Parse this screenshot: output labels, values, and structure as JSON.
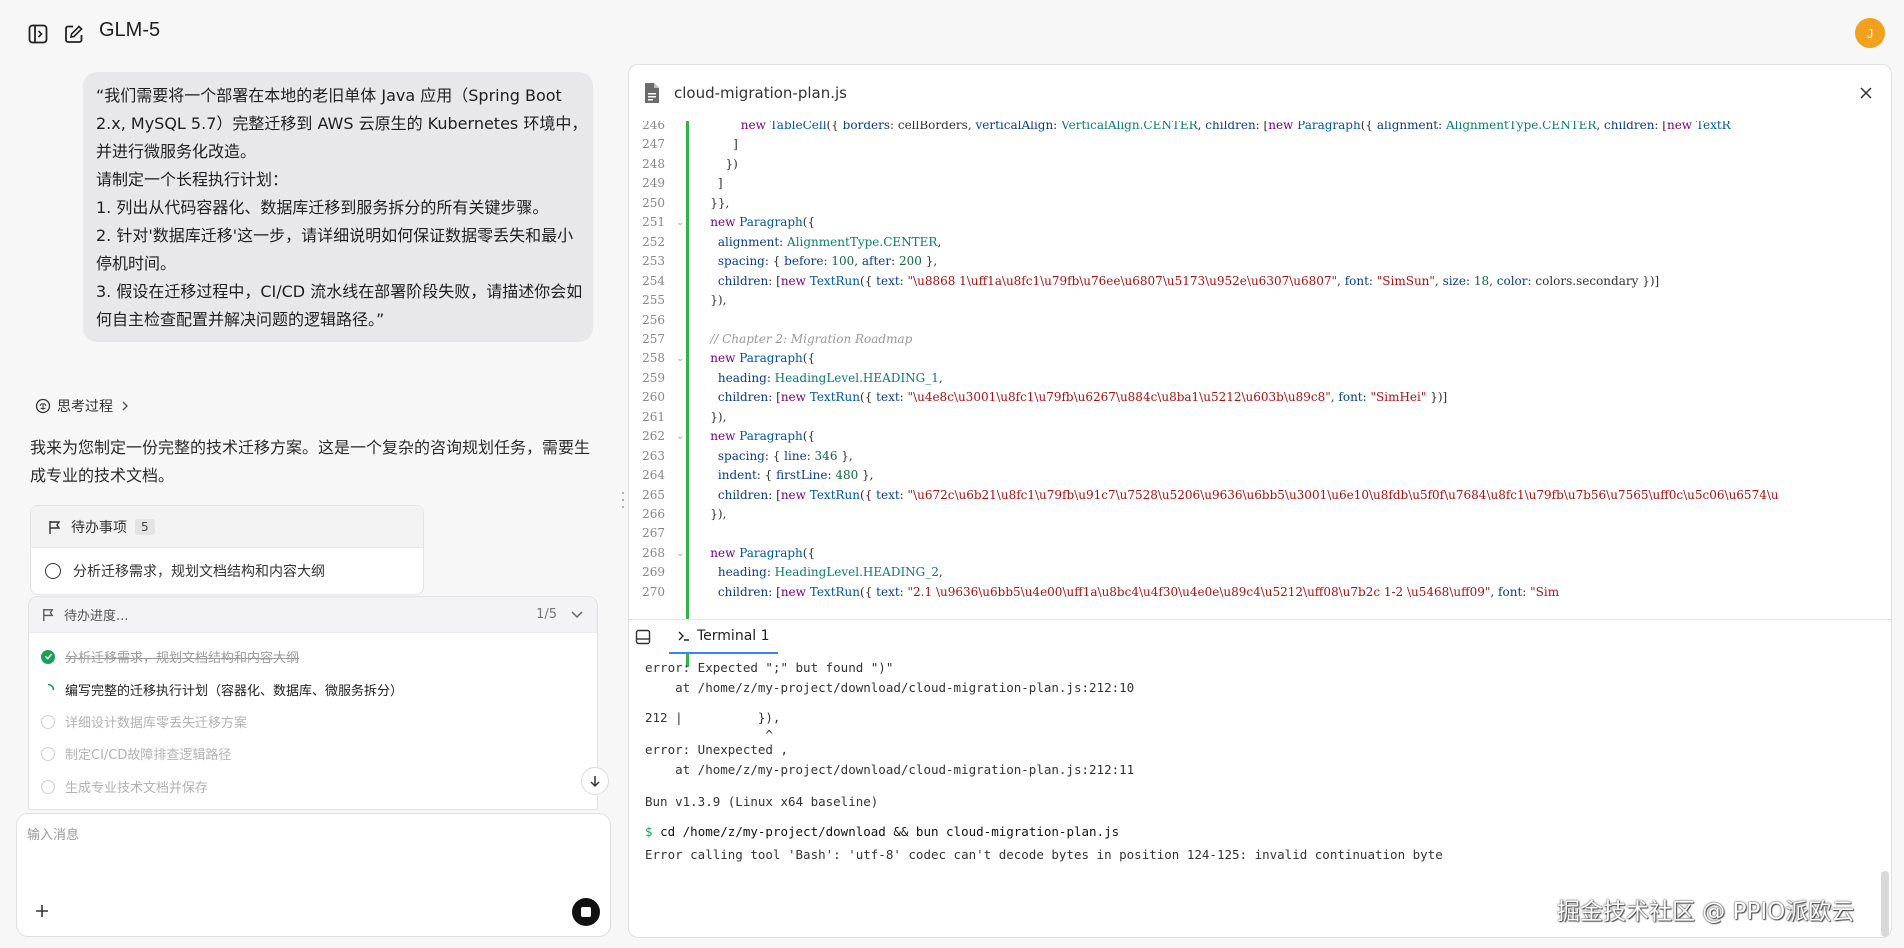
{
  "app": {
    "title": "GLM-5",
    "avatar_letter": "J"
  },
  "user_message": {
    "lines": [
      "“我们需要将一个部署在本地的老旧单体 Java 应用（Spring Boot",
      "2.x, MySQL 5.7）完整迁移到 AWS 云原生的 Kubernetes 环境中，",
      "并进行微服务化改造。",
      "请制定一个长程执行计划：",
      "1. 列出从代码容器化、数据库迁移到服务拆分的所有关键步骤。",
      "2. 针对'数据库迁移'这一步，请详细说明如何保证数据零丢失和最小",
      "停机时间。",
      "3. 假设在迁移过程中，CI/CD 流水线在部署阶段失败，请描述你会如",
      "何自主检查配置并解决问题的逻辑路径。”"
    ]
  },
  "thinking_label": "思考过程",
  "assistant_lines": [
    "我来为您制定一份完整的技术迁移方案。这是一个复杂的咨询规划任务，需要生",
    "成专业的技术文档。"
  ],
  "todo_card": {
    "title": "待办事项",
    "count": "5",
    "first_item": "分析迁移需求，规划文档结构和内容大纲"
  },
  "progress": {
    "title": "待办进度...",
    "count": "1/5",
    "items": [
      {
        "label": "分析迁移需求，规划文档结构和内容大纲",
        "state": "done"
      },
      {
        "label": "编写完整的迁移执行计划（容器化、数据库、微服务拆分）",
        "state": "active"
      },
      {
        "label": "详细设计数据库零丢失迁移方案",
        "state": "pending"
      },
      {
        "label": "制定CI/CD故障排查逻辑路径",
        "state": "pending"
      },
      {
        "label": "生成专业技术文档并保存",
        "state": "pending"
      }
    ]
  },
  "composer": {
    "placeholder": "输入消息"
  },
  "editor": {
    "file_name": "cloud-migration-plan.js",
    "lines": [
      {
        "n": "246",
        "fold": "",
        "code": "            new TableCell({ borders: cellBorders, verticalAlign: VerticalAlign.CENTER, children: [new Paragraph({ alignment: AlignmentType.CENTER, children: [new TextR"
      },
      {
        "n": "247",
        "fold": "",
        "code": "          ]"
      },
      {
        "n": "248",
        "fold": "",
        "code": "        })"
      },
      {
        "n": "249",
        "fold": "",
        "code": "      ]"
      },
      {
        "n": "250",
        "fold": "",
        "code": "    }},"
      },
      {
        "n": "251",
        "fold": "v",
        "code": "    new Paragraph({"
      },
      {
        "n": "252",
        "fold": "",
        "code": "      alignment: AlignmentType.CENTER,"
      },
      {
        "n": "253",
        "fold": "",
        "code": "      spacing: { before: 100, after: 200 },"
      },
      {
        "n": "254",
        "fold": "",
        "code": "      children: [new TextRun({ text: \"\\u8868 1\\uff1a\\u8fc1\\u79fb\\u76ee\\u6807\\u5173\\u952e\\u6307\\u6807\", font: \"SimSun\", size: 18, color: colors.secondary })]"
      },
      {
        "n": "255",
        "fold": "",
        "code": "    }),"
      },
      {
        "n": "256",
        "fold": "",
        "code": ""
      },
      {
        "n": "257",
        "fold": "",
        "code": "    // Chapter 2: Migration Roadmap"
      },
      {
        "n": "258",
        "fold": "v",
        "code": "    new Paragraph({"
      },
      {
        "n": "259",
        "fold": "",
        "code": "      heading: HeadingLevel.HEADING_1,"
      },
      {
        "n": "260",
        "fold": "",
        "code": "      children: [new TextRun({ text: \"\\u4e8c\\u3001\\u8fc1\\u79fb\\u6267\\u884c\\u8ba1\\u5212\\u603b\\u89c8\", font: \"SimHei\" })]"
      },
      {
        "n": "261",
        "fold": "",
        "code": "    }),"
      },
      {
        "n": "262",
        "fold": "v",
        "code": "    new Paragraph({"
      },
      {
        "n": "263",
        "fold": "",
        "code": "      spacing: { line: 346 },"
      },
      {
        "n": "264",
        "fold": "",
        "code": "      indent: { firstLine: 480 },"
      },
      {
        "n": "265",
        "fold": "",
        "code": "      children: [new TextRun({ text: \"\\u672c\\u6b21\\u8fc1\\u79fb\\u91c7\\u7528\\u5206\\u9636\\u6bb5\\u3001\\u6e10\\u8fdb\\u5f0f\\u7684\\u8fc1\\u79fb\\u7b56\\u7565\\uff0c\\u5c06\\u6574\\u"
      },
      {
        "n": "266",
        "fold": "",
        "code": "    }),"
      },
      {
        "n": "267",
        "fold": "",
        "code": ""
      },
      {
        "n": "268",
        "fold": "v",
        "code": "    new Paragraph({"
      },
      {
        "n": "269",
        "fold": "",
        "code": "      heading: HeadingLevel.HEADING_2,"
      },
      {
        "n": "270",
        "fold": "",
        "code": "      children: [new TextRun({ text: \"2.1 \\u9636\\u6bb5\\u4e00\\uff1a\\u8bc4\\u4f30\\u4e0e\\u89c4\\u5212\\uff08\\u7b2c 1-2 \\u5468\\uff09\", font: \"Sim"
      }
    ]
  },
  "terminal": {
    "tab_label": "Terminal 1",
    "lines": [
      {
        "text": "error: Expected \";\" but found \")\"",
        "kind": "plain"
      },
      {
        "text": "    at /home/z/my-project/download/cloud-migration-plan.js:212:10",
        "kind": "plain"
      },
      {
        "text": "",
        "kind": "plain"
      },
      {
        "text": "212 |          }),",
        "kind": "plain"
      },
      {
        "text": "                ^",
        "kind": "plain"
      },
      {
        "text": "error: Unexpected ,",
        "kind": "plain"
      },
      {
        "text": "    at /home/z/my-project/download/cloud-migration-plan.js:212:11",
        "kind": "plain"
      },
      {
        "text": "",
        "kind": "plain"
      },
      {
        "text": "Bun v1.3.9 (Linux x64 baseline)",
        "kind": "plain"
      },
      {
        "text": "",
        "kind": "plain"
      },
      {
        "text": "cd /home/z/my-project/download && bun cloud-migration-plan.js",
        "kind": "cmd",
        "prompt": "$"
      },
      {
        "text": "Error calling tool 'Bash': 'utf-8' codec can't decode bytes in position 124-125: invalid continuation byte",
        "kind": "plain"
      }
    ]
  },
  "watermark": "掘金技术社区 @ PPIO派欧云",
  "colors": {
    "accent_green": "#1aa05a",
    "avatar": "#f2a11c",
    "tab_underline": "#3b82f6",
    "diff_bar": "#35b34a"
  }
}
